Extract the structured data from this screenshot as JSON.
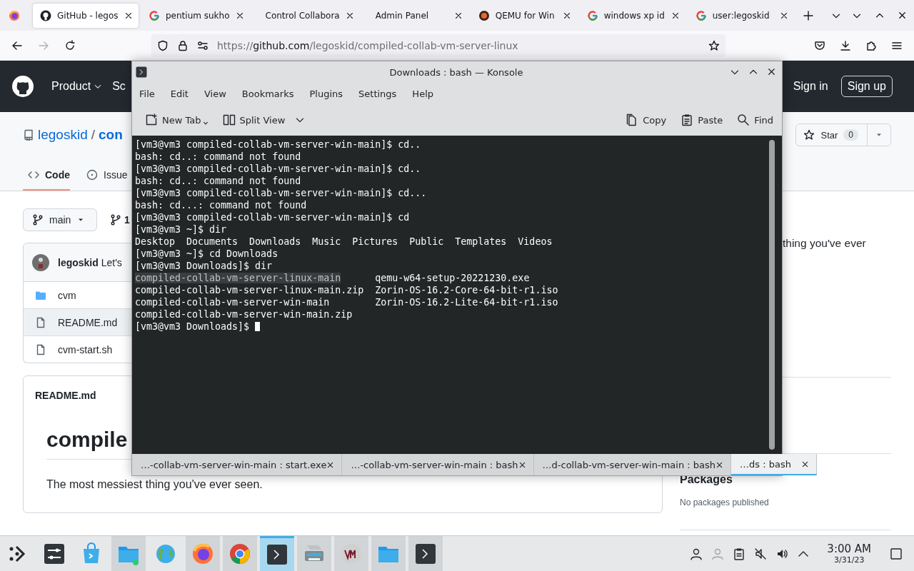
{
  "browser": {
    "tabs": [
      {
        "kind": "github",
        "label": "GitHub - legos",
        "selected": true
      },
      {
        "kind": "google",
        "label": "pentium sukho",
        "selected": false
      },
      {
        "kind": "none",
        "label": "Control Collabora",
        "selected": false
      },
      {
        "kind": "none",
        "label": "Admin Panel",
        "selected": false
      },
      {
        "kind": "qemu",
        "label": "QEMU for Win",
        "selected": false
      },
      {
        "kind": "google",
        "label": "windows xp id",
        "selected": false
      },
      {
        "kind": "google",
        "label": "user:legoskid",
        "selected": false
      }
    ],
    "url": {
      "scheme": "https://",
      "host": "github.com",
      "path": "/legoskid/compiled-collab-vm-server-linux"
    }
  },
  "github": {
    "nav": [
      "Product",
      "Sc"
    ],
    "sign_in": "Sign in",
    "sign_up": "Sign up",
    "owner": "legoskid",
    "separator": "/",
    "repo": "con",
    "tabs": [
      {
        "label": "Code",
        "selected": true
      },
      {
        "label": "Issue",
        "selected": false
      }
    ],
    "star": {
      "label": "Star",
      "count": "0"
    },
    "branch": "main",
    "branch_count": "1",
    "commit": {
      "author": "legoskid",
      "message": "Let's"
    },
    "files": [
      {
        "kind": "folder",
        "name": "cvm",
        "hovered": false
      },
      {
        "kind": "file",
        "name": "README.md",
        "hovered": true
      },
      {
        "kind": "file",
        "name": "cvm-start.sh",
        "hovered": false
      }
    ],
    "readme": {
      "title": "README.md",
      "heading": "compile",
      "text": "The most messiest thing you've ever seen."
    },
    "about": "thing you've ever",
    "packages": {
      "title": "Packages",
      "text": "No packages published"
    }
  },
  "konsole": {
    "title": "Downloads : bash — Konsole",
    "menu": [
      "File",
      "Edit",
      "View",
      "Bookmarks",
      "Plugins",
      "Settings",
      "Help"
    ],
    "toolbar_left": [
      {
        "kind": "new-tab",
        "label": "New Tab"
      },
      {
        "kind": "split",
        "label": "Split View"
      }
    ],
    "toolbar_right": [
      {
        "kind": "copy",
        "label": "Copy"
      },
      {
        "kind": "paste",
        "label": "Paste"
      },
      {
        "kind": "find",
        "label": "Find"
      }
    ],
    "lines": [
      {
        "text": "[vm3@vm3 compiled-collab-vm-server-win-main]$ cd.."
      },
      {
        "text": "bash: cd..: command not found"
      },
      {
        "text": "[vm3@vm3 compiled-collab-vm-server-win-main]$ cd.."
      },
      {
        "text": "bash: cd..: command not found"
      },
      {
        "text": "[vm3@vm3 compiled-collab-vm-server-win-main]$ cd..."
      },
      {
        "text": "bash: cd...: command not found"
      },
      {
        "text": "[vm3@vm3 compiled-collab-vm-server-win-main]$ cd"
      },
      {
        "text": "[vm3@vm3 ~]$ dir"
      },
      {
        "text": "Desktop  Documents  Downloads  Music  Pictures  Public  Templates  Videos"
      },
      {
        "text": "[vm3@vm3 ~]$ cd Downloads"
      },
      {
        "text": "[vm3@vm3 Downloads]$ dir"
      },
      {
        "segments": [
          {
            "text": "compiled-collab-vm-server-linux-main",
            "selected": true
          },
          {
            "text": "      qemu-w64-setup-20221230.exe",
            "selected": false
          }
        ]
      },
      {
        "text": "compiled-collab-vm-server-linux-main.zip  Zorin-OS-16.2-Core-64-bit-r1.iso"
      },
      {
        "text": "compiled-collab-vm-server-win-main        Zorin-OS-16.2-Lite-64-bit-r1.iso"
      },
      {
        "text": "compiled-collab-vm-server-win-main.zip"
      },
      {
        "text": "[vm3@vm3 Downloads]$ ",
        "cursor": true
      }
    ],
    "tabs": [
      {
        "label": "…-collab-vm-server-win-main : start.exe",
        "selected": false
      },
      {
        "label": "…-collab-vm-server-win-main : bash",
        "selected": false
      },
      {
        "label": "…d-collab-vm-server-win-main : bash",
        "selected": false
      },
      {
        "label": "…ds : bash",
        "selected": true
      }
    ]
  },
  "taskbar": {
    "items": [
      {
        "kind": "launcher",
        "running": false,
        "selected": false
      },
      {
        "kind": "settings",
        "running": false,
        "selected": false
      },
      {
        "kind": "store",
        "running": false,
        "selected": false
      },
      {
        "kind": "files",
        "running": true,
        "selected": false
      },
      {
        "kind": "globe",
        "running": false,
        "selected": false
      },
      {
        "kind": "firefox",
        "running": true,
        "selected": false
      },
      {
        "kind": "chrome",
        "running": true,
        "selected": false
      },
      {
        "kind": "terminal",
        "running": true,
        "selected": true
      },
      {
        "kind": "scanner",
        "running": true,
        "selected": false
      },
      {
        "kind": "vm",
        "running": true,
        "selected": false
      },
      {
        "kind": "folder",
        "running": true,
        "selected": false
      },
      {
        "kind": "terminal",
        "running": true,
        "selected": false
      }
    ],
    "time": "3:00 AM",
    "date": "3/31/23"
  }
}
